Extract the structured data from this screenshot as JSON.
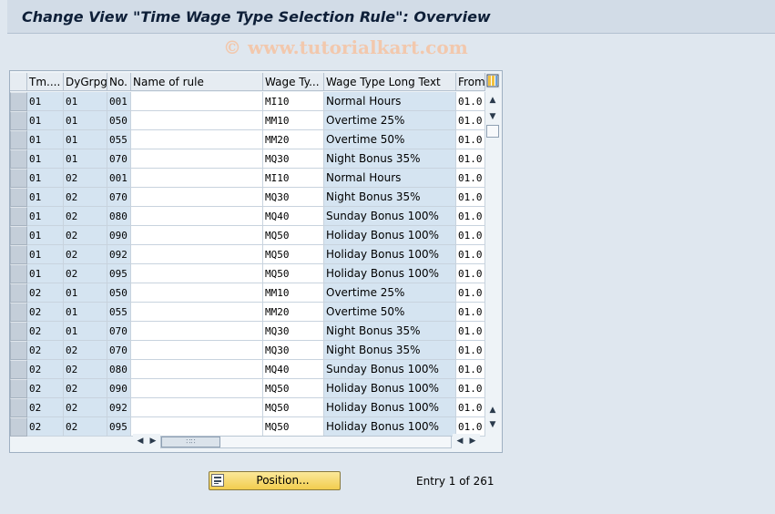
{
  "window": {
    "title": "Change View \"Time Wage Type Selection Rule\": Overview"
  },
  "watermark": "© www.tutorialkart.com",
  "table": {
    "columns": [
      "Tm....",
      "DyGrpg",
      "No.",
      "Name of rule",
      "Wage Ty...",
      "Wage Type Long Text",
      "From"
    ],
    "rows": [
      [
        "01",
        "01",
        "001",
        "",
        "MI10",
        "Normal Hours",
        "01.0"
      ],
      [
        "01",
        "01",
        "050",
        "",
        "MM10",
        "Overtime 25%",
        "01.0"
      ],
      [
        "01",
        "01",
        "055",
        "",
        "MM20",
        "Overtime 50%",
        "01.0"
      ],
      [
        "01",
        "01",
        "070",
        "",
        "MQ30",
        "Night Bonus 35%",
        "01.0"
      ],
      [
        "01",
        "02",
        "001",
        "",
        "MI10",
        "Normal Hours",
        "01.0"
      ],
      [
        "01",
        "02",
        "070",
        "",
        "MQ30",
        "Night Bonus 35%",
        "01.0"
      ],
      [
        "01",
        "02",
        "080",
        "",
        "MQ40",
        "Sunday Bonus 100%",
        "01.0"
      ],
      [
        "01",
        "02",
        "090",
        "",
        "MQ50",
        "Holiday Bonus 100%",
        "01.0"
      ],
      [
        "01",
        "02",
        "092",
        "",
        "MQ50",
        "Holiday Bonus 100%",
        "01.0"
      ],
      [
        "01",
        "02",
        "095",
        "",
        "MQ50",
        "Holiday Bonus 100%",
        "01.0"
      ],
      [
        "02",
        "01",
        "050",
        "",
        "MM10",
        "Overtime 25%",
        "01.0"
      ],
      [
        "02",
        "01",
        "055",
        "",
        "MM20",
        "Overtime 50%",
        "01.0"
      ],
      [
        "02",
        "01",
        "070",
        "",
        "MQ30",
        "Night Bonus 35%",
        "01.0"
      ],
      [
        "02",
        "02",
        "070",
        "",
        "MQ30",
        "Night Bonus 35%",
        "01.0"
      ],
      [
        "02",
        "02",
        "080",
        "",
        "MQ40",
        "Sunday Bonus 100%",
        "01.0"
      ],
      [
        "02",
        "02",
        "090",
        "",
        "MQ50",
        "Holiday Bonus 100%",
        "01.0"
      ],
      [
        "02",
        "02",
        "092",
        "",
        "MQ50",
        "Holiday Bonus 100%",
        "01.0"
      ],
      [
        "02",
        "02",
        "095",
        "",
        "MQ50",
        "Holiday Bonus 100%",
        "01.0"
      ]
    ]
  },
  "footer": {
    "position_button": "Position...",
    "entry_info": "Entry 1 of 261"
  }
}
